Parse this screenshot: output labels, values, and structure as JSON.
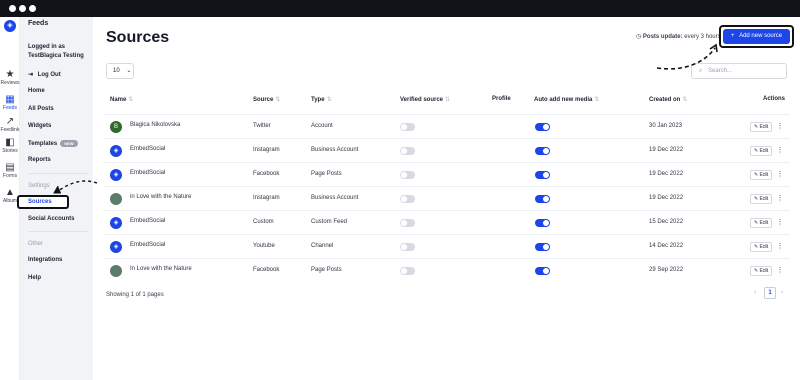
{
  "colors": {
    "accent": "#1e45e6",
    "topbar": "#121318",
    "sidebar": "#f1f3f6"
  },
  "rail": [
    {
      "icon": "star-icon",
      "glyph": "★",
      "label": "Reviews",
      "active": false
    },
    {
      "icon": "grid-icon",
      "glyph": "▦",
      "label": "Feeds",
      "active": true
    },
    {
      "icon": "arrow-icon",
      "glyph": "↗",
      "label": "Feedlink",
      "active": false
    },
    {
      "icon": "stories-icon",
      "glyph": "◧",
      "label": "Stories",
      "active": false
    },
    {
      "icon": "clipboard-icon",
      "glyph": "▤",
      "label": "Forms",
      "active": false
    },
    {
      "icon": "mountain-icon",
      "glyph": "▲",
      "label": "Album",
      "active": false
    }
  ],
  "menu": {
    "title": "Feeds",
    "logged_in_line1": "Logged in as",
    "logged_in_line2": "TestBlagica Testing",
    "logout": "Log Out",
    "home": "Home",
    "all_posts": "All Posts",
    "widgets": "Widgets",
    "templates": "Templates",
    "templates_badge": "NEW",
    "reports": "Reports",
    "settings_heading": "Settings",
    "sources": "Sources",
    "social_accounts": "Social Accounts",
    "other_heading": "Other",
    "integrations": "Integrations",
    "help": "Help"
  },
  "header": {
    "title": "Sources",
    "posts_update_label": "Posts update:",
    "posts_update_value": "every 3 hours",
    "add_button": "Add new source"
  },
  "controls": {
    "per_page": "10",
    "search_placeholder": "Search..."
  },
  "table": {
    "columns": {
      "name": "Name",
      "source": "Source",
      "type": "Type",
      "verified": "Verified source",
      "profile": "Profile",
      "auto_add": "Auto add new media",
      "created": "Created on",
      "actions": "Actions"
    },
    "edit_label": "Edit",
    "rows": [
      {
        "name": "Blagica Nikolovska",
        "source": "Twitter",
        "type": "Account",
        "verified": false,
        "auto_add": true,
        "created": "30 Jan 2023",
        "avatar": "letter",
        "avatar_letter": "B",
        "avatar_color": "#2f6b2c"
      },
      {
        "name": "EmbedSocial",
        "source": "Instagram",
        "type": "Business Account",
        "verified": false,
        "auto_add": true,
        "created": "19 Dec 2022",
        "avatar": "logo",
        "avatar_color": "#1e45e6"
      },
      {
        "name": "EmbedSocial",
        "source": "Facebook",
        "type": "Page Posts",
        "verified": false,
        "auto_add": true,
        "created": "19 Dec 2022",
        "avatar": "logo",
        "avatar_color": "#1e45e6"
      },
      {
        "name": "in Love with the Nature",
        "source": "Instagram",
        "type": "Business Account",
        "verified": false,
        "auto_add": true,
        "created": "19 Dec 2022",
        "avatar": "photo",
        "avatar_color": "#5a7d6a"
      },
      {
        "name": "EmbedSocial",
        "source": "Custom",
        "type": "Custom Feed",
        "verified": false,
        "auto_add": true,
        "created": "15 Dec 2022",
        "avatar": "logo",
        "avatar_color": "#1e45e6"
      },
      {
        "name": "EmbedSocial",
        "source": "Youtube",
        "type": "Channel",
        "verified": false,
        "auto_add": true,
        "created": "14 Dec 2022",
        "avatar": "logo",
        "avatar_color": "#1e45e6"
      },
      {
        "name": "In Love with the Nature",
        "source": "Facebook",
        "type": "Page Posts",
        "verified": false,
        "auto_add": true,
        "created": "29 Sep 2022",
        "avatar": "photo",
        "avatar_color": "#5a7d6a"
      }
    ]
  },
  "footer": {
    "showing": "Showing 1 of 1 pages",
    "current_page": "1"
  }
}
